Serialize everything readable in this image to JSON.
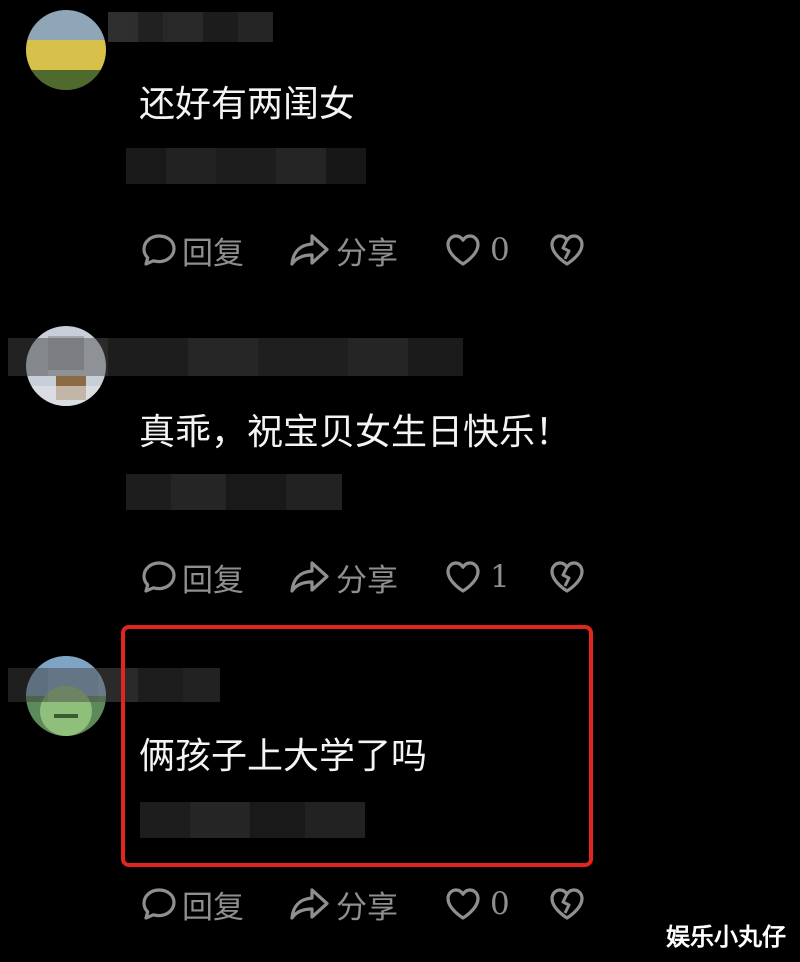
{
  "comments": [
    {
      "text": "还好有两闺女",
      "reply_label": "回复",
      "share_label": "分享",
      "like_count": "0"
    },
    {
      "text": "真乖，祝宝贝女生日快乐！",
      "reply_label": "回复",
      "share_label": "分享",
      "like_count": "1"
    },
    {
      "text": "俩孩子上大学了吗",
      "reply_label": "回复",
      "share_label": "分享",
      "like_count": "0"
    }
  ],
  "watermark": "娱乐小丸仔",
  "colors": {
    "background": "#000000",
    "comment_text": "#f4f4f4",
    "action_gray": "#8f8f8f",
    "highlight_red": "#e0261f"
  },
  "icons": [
    "comment-bubble-icon",
    "share-arrow-icon",
    "heart-icon",
    "broken-heart-icon"
  ]
}
